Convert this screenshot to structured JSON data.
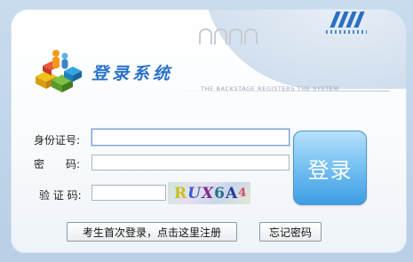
{
  "header": {
    "title": "登录系统",
    "subtitle": "THE BACKSTAGE REGISTERS THE SYSTEM"
  },
  "form": {
    "id_label": "身份证号:",
    "id_value": "",
    "password_label": "密　　码:",
    "password_value": "",
    "captcha_label": "验 证 码:",
    "captcha_value": "",
    "captcha_text": [
      "R",
      "U",
      "X",
      "6",
      "A",
      "4"
    ]
  },
  "buttons": {
    "login": "登录",
    "register": "考生首次登录，点击这里注册",
    "forgot": "忘记密码"
  },
  "colors": {
    "title": "#2a73c9",
    "login_button": "#3d9ce2",
    "background": "#c9dbee"
  },
  "icons": [
    "people-blocks-logo-icon"
  ]
}
